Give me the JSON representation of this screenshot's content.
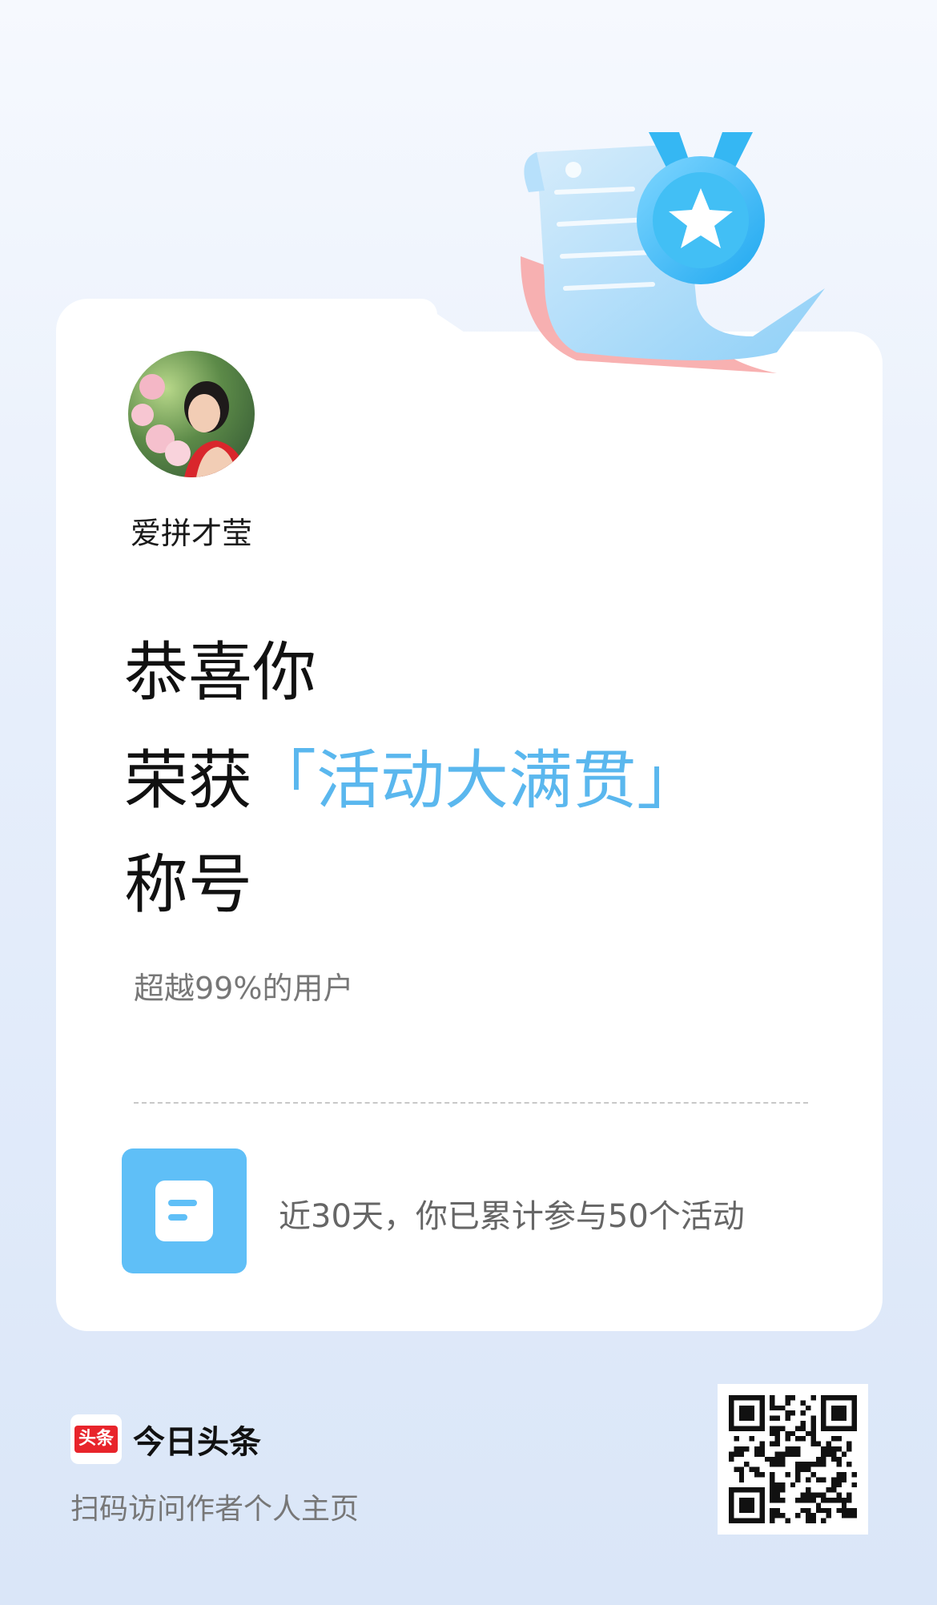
{
  "user": {
    "name": "爱拼才莹"
  },
  "headline": {
    "line1": "恭喜你",
    "line2_prefix": "荣获",
    "title": "「活动大满贯」",
    "line3": "称号"
  },
  "rank_text": "超越99%的用户",
  "stats": {
    "text": "近30天，你已累计参与50个活动",
    "icon": "document-icon"
  },
  "footer": {
    "brand_logo_text": "头条",
    "brand_name": "今日头条",
    "scan_hint": "扫码访问作者个人主页"
  },
  "colors": {
    "accent": "#5ab7ee",
    "brand_red": "#e8242b",
    "stat_icon_bg": "#5fbff7"
  },
  "icons": {
    "badge": "medal-certificate-icon",
    "qr": "qr-code-icon"
  }
}
